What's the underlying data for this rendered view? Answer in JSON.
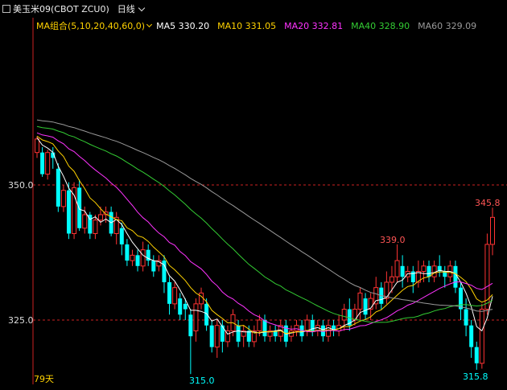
{
  "header": {
    "symbol": "美玉米09(CBOT ZCU0)",
    "period": "日线"
  },
  "legend": {
    "combo_label": "MA组合(5,10,20,40,60,0)",
    "items": [
      {
        "label": "MA5 330.20",
        "color": "#ffffff"
      },
      {
        "label": "MA10 331.05",
        "color": "#ffd200"
      },
      {
        "label": "MA20 332.81",
        "color": "#ff33ff"
      },
      {
        "label": "MA40 328.90",
        "color": "#33cc33"
      },
      {
        "label": "MA60 329.09",
        "color": "#999999"
      }
    ]
  },
  "chart_data": {
    "type": "candlestick",
    "y_ticks": [
      "350.0",
      "325.0"
    ],
    "ylim": [
      314,
      360
    ],
    "annotations": {
      "high_1": "339.0",
      "high_2": "345.8",
      "low_1": "315.0",
      "low_2": "315.8"
    },
    "bottom_label": "79天",
    "colors": {
      "up": "#ff3333",
      "down": "#00ffff",
      "grid": "#cc2222"
    },
    "candles": [
      [
        356,
        358.5,
        359,
        355
      ],
      [
        356,
        352,
        357,
        351.5
      ],
      [
        352,
        356,
        356.5,
        351
      ],
      [
        356,
        355,
        357,
        353
      ],
      [
        353,
        346,
        354,
        345
      ],
      [
        346,
        349,
        350,
        345
      ],
      [
        349,
        341,
        350.5,
        340
      ],
      [
        341,
        349.5,
        350.5,
        340
      ],
      [
        349.5,
        342,
        351,
        341.5
      ],
      [
        342,
        344.5,
        346,
        341
      ],
      [
        344.5,
        341,
        345,
        340
      ],
      [
        341,
        343.5,
        344.5,
        340
      ],
      [
        343.5,
        344.5,
        346,
        342.5
      ],
      [
        344.5,
        345,
        346,
        343
      ],
      [
        345,
        341,
        346,
        340.5
      ],
      [
        341,
        344,
        345,
        339
      ],
      [
        342,
        339,
        343,
        337
      ],
      [
        339,
        336,
        340,
        335
      ],
      [
        336,
        337,
        338,
        335
      ],
      [
        337,
        335,
        338,
        334
      ],
      [
        335,
        338,
        339.5,
        334
      ],
      [
        338,
        336,
        339,
        335
      ],
      [
        336,
        334,
        337,
        333
      ],
      [
        335,
        336,
        337,
        334
      ],
      [
        336,
        332,
        337,
        330
      ],
      [
        332,
        328,
        333,
        326
      ],
      [
        328,
        331,
        332,
        327
      ],
      [
        329,
        326,
        330,
        325
      ],
      [
        328,
        327,
        329,
        325
      ],
      [
        326,
        322,
        327,
        315
      ],
      [
        323,
        328,
        329,
        321
      ],
      [
        328,
        330,
        331,
        327
      ],
      [
        328,
        324,
        329,
        323
      ],
      [
        324,
        320,
        325,
        319
      ],
      [
        320,
        324,
        325,
        318
      ],
      [
        324,
        321,
        325,
        319
      ],
      [
        321,
        323,
        324,
        320
      ],
      [
        323,
        326,
        327,
        322
      ],
      [
        324,
        321,
        325,
        320
      ],
      [
        322,
        323,
        324,
        320
      ],
      [
        323,
        321,
        324,
        320
      ],
      [
        321,
        323,
        324,
        320
      ],
      [
        323,
        325,
        326,
        322
      ],
      [
        325,
        322,
        326,
        321
      ],
      [
        322,
        323,
        324,
        321
      ],
      [
        323,
        322,
        324,
        321
      ],
      [
        322,
        324,
        325,
        321
      ],
      [
        324,
        321,
        325,
        320
      ],
      [
        322,
        323,
        324,
        321
      ],
      [
        323,
        324,
        325,
        322
      ],
      [
        324,
        322,
        325,
        321
      ],
      [
        323,
        325,
        326,
        322
      ],
      [
        325,
        323,
        326,
        322
      ],
      [
        323,
        324,
        325,
        322
      ],
      [
        324,
        322,
        325,
        321
      ],
      [
        322,
        324,
        325,
        321
      ],
      [
        324,
        323,
        325,
        322
      ],
      [
        323,
        324,
        326,
        322
      ],
      [
        325,
        327,
        328,
        323
      ],
      [
        327,
        324,
        329,
        323
      ],
      [
        325,
        327,
        328,
        324
      ],
      [
        327,
        330,
        331,
        325
      ],
      [
        329,
        326,
        330,
        325
      ],
      [
        327,
        329,
        330,
        325
      ],
      [
        328,
        331,
        333,
        327
      ],
      [
        331,
        328,
        332,
        327
      ],
      [
        329,
        332,
        334,
        328
      ],
      [
        332,
        333,
        335,
        330
      ],
      [
        333,
        336,
        339,
        332
      ],
      [
        335,
        333,
        337,
        331
      ],
      [
        333,
        334,
        335,
        332
      ],
      [
        334,
        332,
        335,
        330
      ],
      [
        332,
        334,
        336,
        331
      ],
      [
        334,
        335,
        336,
        332
      ],
      [
        335,
        333,
        336,
        332
      ],
      [
        333,
        335,
        336,
        332
      ],
      [
        335,
        334,
        337,
        333
      ],
      [
        334,
        333,
        335,
        331
      ],
      [
        333,
        335,
        336,
        332
      ],
      [
        335,
        331,
        336,
        330
      ],
      [
        331,
        327,
        332,
        325
      ],
      [
        327,
        324,
        329,
        322
      ],
      [
        324,
        320,
        325,
        318
      ],
      [
        320,
        317,
        321,
        315.8
      ],
      [
        317,
        327,
        328,
        316
      ],
      [
        327,
        339,
        341,
        326
      ],
      [
        339,
        344,
        345.8,
        337
      ]
    ]
  }
}
